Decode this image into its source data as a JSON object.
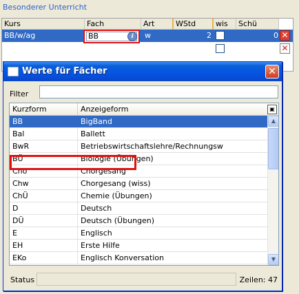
{
  "background": {
    "header": "Besonderer Unterricht",
    "columns": [
      "Kurs",
      "Fach",
      "Art",
      "WStd",
      "wis",
      "Schü"
    ],
    "row": {
      "kurs": "BB/w/ag",
      "fach": "BB",
      "art": "w",
      "wstd": "2",
      "schue": "0"
    }
  },
  "dialog": {
    "title": "Werte für Fächer",
    "close_label": "✕",
    "filter_label": "Filter",
    "filter_value": "",
    "columns": [
      "Kurzform",
      "Anzeigeform"
    ],
    "rows": [
      {
        "kurz": "BB",
        "anzeige": "BigBand"
      },
      {
        "kurz": "Bal",
        "anzeige": "Ballett"
      },
      {
        "kurz": "BwR",
        "anzeige": "Betriebswirtschaftslehre/Rechnungsw"
      },
      {
        "kurz": "BÜ",
        "anzeige": "Biologie (Übungen)"
      },
      {
        "kurz": "Cho",
        "anzeige": "Chorgesang"
      },
      {
        "kurz": "Chw",
        "anzeige": "Chorgesang (wiss)"
      },
      {
        "kurz": "ChÜ",
        "anzeige": "Chemie (Übungen)"
      },
      {
        "kurz": "D",
        "anzeige": "Deutsch"
      },
      {
        "kurz": "DÜ",
        "anzeige": "Deutsch (Übungen)"
      },
      {
        "kurz": "E",
        "anzeige": "Englisch"
      },
      {
        "kurz": "EH",
        "anzeige": "Erste Hilfe"
      },
      {
        "kurz": "EKo",
        "anzeige": "Englisch Konversation"
      }
    ],
    "status_label": "Status",
    "count_label": "Zeilen: 47"
  },
  "colors": {
    "selection": "#316ac5",
    "highlight_outline": "#e01010",
    "title_bar": "#0554e3"
  }
}
